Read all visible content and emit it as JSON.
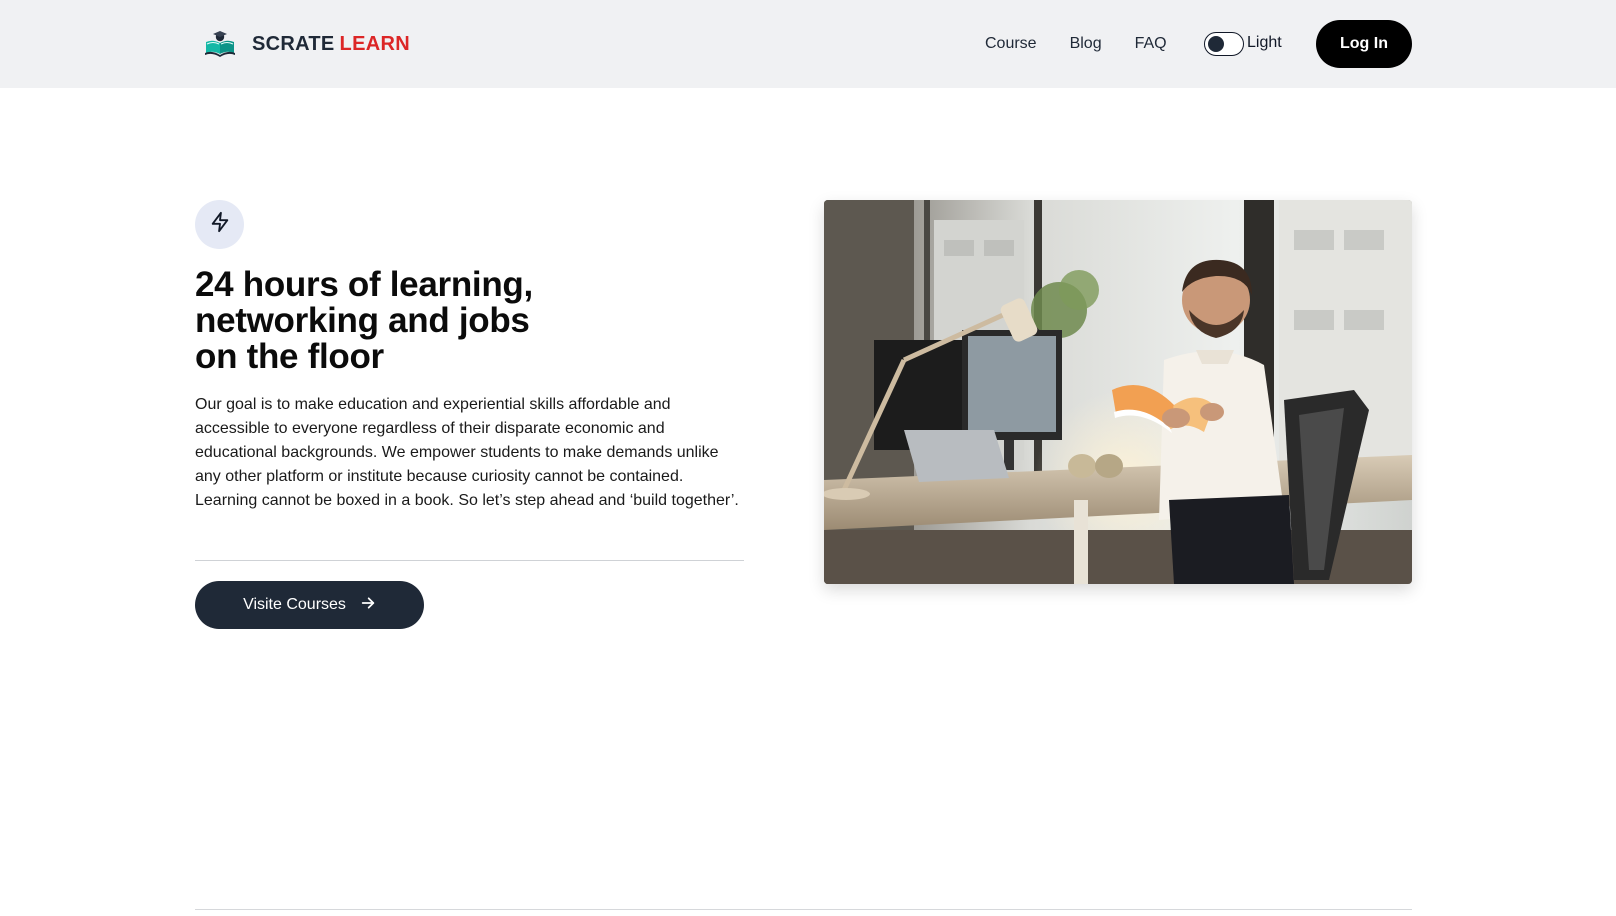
{
  "header": {
    "brand": {
      "part1": "SCRATE",
      "part2": "LEARN",
      "logo_icon": "book-reader-icon"
    },
    "nav": [
      {
        "label": "Course"
      },
      {
        "label": "Blog"
      },
      {
        "label": "FAQ"
      }
    ],
    "theme_toggle": {
      "label": "Light",
      "state": "off"
    },
    "login_label": "Log In"
  },
  "hero": {
    "badge_icon": "lightning-bolt-icon",
    "title_lines": [
      "24 hours of learning,",
      "networking and jobs",
      "on the floor"
    ],
    "description": "Our goal is to make education and experiential skills affordable and accessible to everyone regardless of their disparate economic and educational backgrounds. We empower students to make demands unlike any other platform or institute because curiosity cannot be contained. Learning cannot be boxed in a book. So let’s step ahead and ‘build together’.",
    "cta_label": "Visite Courses",
    "cta_icon": "arrow-right-icon",
    "image_icon": "office-reading-photo"
  },
  "colors": {
    "header_bg": "#f0f1f3",
    "brand_accent": "#dc2626",
    "button_dark": "#1f2937",
    "login_bg": "#000000"
  }
}
